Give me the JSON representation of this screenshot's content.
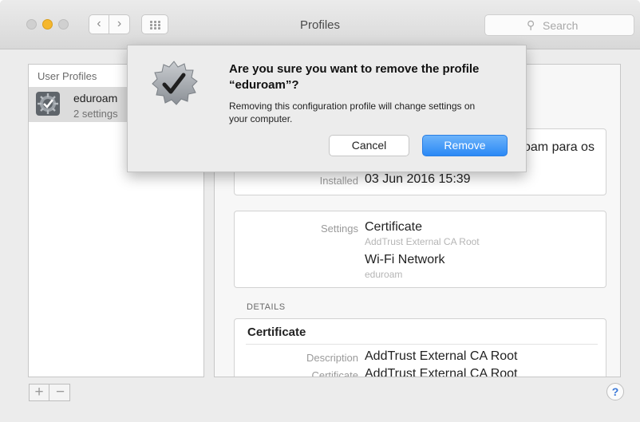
{
  "window": {
    "title": "Profiles"
  },
  "toolbar": {
    "back_glyph": "‹",
    "forward_glyph": "›",
    "search_placeholder": "Search",
    "search_icon": "magnifier-icon"
  },
  "sidebar": {
    "header": "User Profiles",
    "items": [
      {
        "name": "eduroam",
        "subtitle": "2 settings",
        "icon": "gear-checkmark-icon"
      }
    ],
    "add_label": "+",
    "remove_label": "−"
  },
  "detail": {
    "description_partial": "oam para os",
    "installed_label": "Installed",
    "installed_value": "03 Jun 2016 15:39",
    "settings_label": "Settings",
    "settings": [
      {
        "name": "Certificate",
        "sub": "AddTrust External CA Root"
      },
      {
        "name": "Wi-Fi Network",
        "sub": "eduroam"
      }
    ],
    "details_heading": "DETAILS",
    "certificate": {
      "title": "Certificate",
      "description_label": "Description",
      "description_value": "AddTrust External CA Root",
      "certificate_label": "Certificate",
      "certificate_value": "AddTrust External CA Root"
    }
  },
  "help": {
    "label": "?"
  },
  "dialog": {
    "title": "Are you sure you want to remove the profile “eduroam”?",
    "message": "Removing this configuration profile will change settings on your computer.",
    "cancel_label": "Cancel",
    "remove_label": "Remove",
    "icon": "checkmark-badge-icon"
  },
  "colors": {
    "accent": "#2b89f5",
    "minimize_light": "#f5b72d"
  }
}
